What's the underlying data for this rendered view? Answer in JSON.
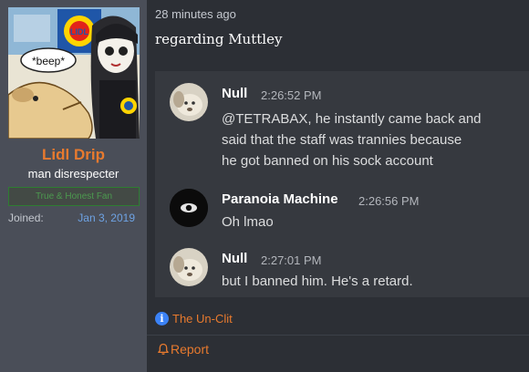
{
  "user": {
    "name": "Lidl Drip",
    "title": "man disrespecter",
    "banner": "True & Honest Fan",
    "joined_label": "Joined:",
    "joined_value": "Jan 3, 2019",
    "avatar_text": "*beep*",
    "avatar_logo_text": "LIDL"
  },
  "post": {
    "time": "28 minutes ago",
    "text": "regarding Muttley"
  },
  "chat": {
    "messages": [
      {
        "author": "Null",
        "time": "2:26:52 PM",
        "lines": [
          "@TETRABAX, he instantly came back and",
          "said that the staff was trannies because",
          "he got banned on his sock account"
        ]
      },
      {
        "author": "Paranoia Machine",
        "time": "2:26:56 PM",
        "lines": [
          "Oh lmao"
        ]
      },
      {
        "author": "Null",
        "time": "2:27:01 PM",
        "lines": [
          "but I banned him. He's a retard."
        ]
      }
    ]
  },
  "badge": {
    "label": "The Un-Clit",
    "icon": "info-icon"
  },
  "actions": {
    "report_label": "Report",
    "report_icon": "bell-icon"
  },
  "colors": {
    "username": "#e87a2e",
    "accent": "#e87a2e",
    "banner_text": "#4c9a4f",
    "joined_value": "#6ea3e4",
    "info_icon": "#3b82f6"
  }
}
